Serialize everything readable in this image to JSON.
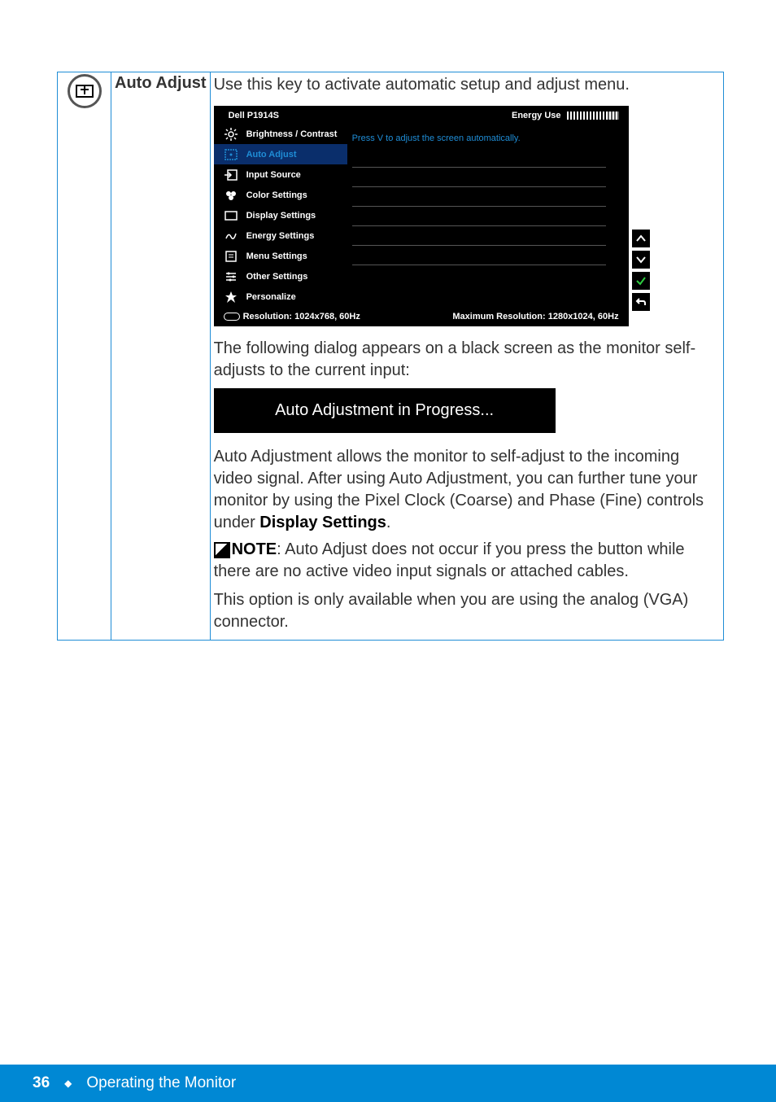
{
  "row": {
    "label": "Auto Adjust",
    "intro": "Use this key to activate automatic setup and adjust menu."
  },
  "osd": {
    "model": "Dell P1914S",
    "energy_label": "Energy Use",
    "menu": [
      "Brightness / Contrast",
      "Auto Adjust",
      "Input Source",
      "Color Settings",
      "Display Settings",
      "Energy Settings",
      "Menu Settings",
      "Other Settings",
      "Personalize"
    ],
    "hint": "Press V  to adjust the screen automatically.",
    "res_current": "Resolution: 1024x768,  60Hz",
    "res_max": "Maximum Resolution: 1280x1024,  60Hz"
  },
  "text": {
    "p1": "The following dialog appears on a black screen as the monitor self-adjusts to the current input:",
    "progress": "Auto Adjustment in Progress...",
    "p2a": "Auto Adjustment allows the monitor to self-adjust to the incoming video signal. After using Auto Adjustment, you can further tune your monitor by using the Pixel Clock (Coarse) and Phase (Fine) controls under ",
    "p2b": "Display Settings",
    "p2c": ".",
    "note_label": "NOTE",
    "note_body": ": Auto Adjust does not occur if you press the button while there are no active video input signals or attached cables.",
    "p3": "This option is only available when you are using the analog (VGA) connector."
  },
  "footer": {
    "page": "36",
    "section": "Operating the Monitor"
  }
}
